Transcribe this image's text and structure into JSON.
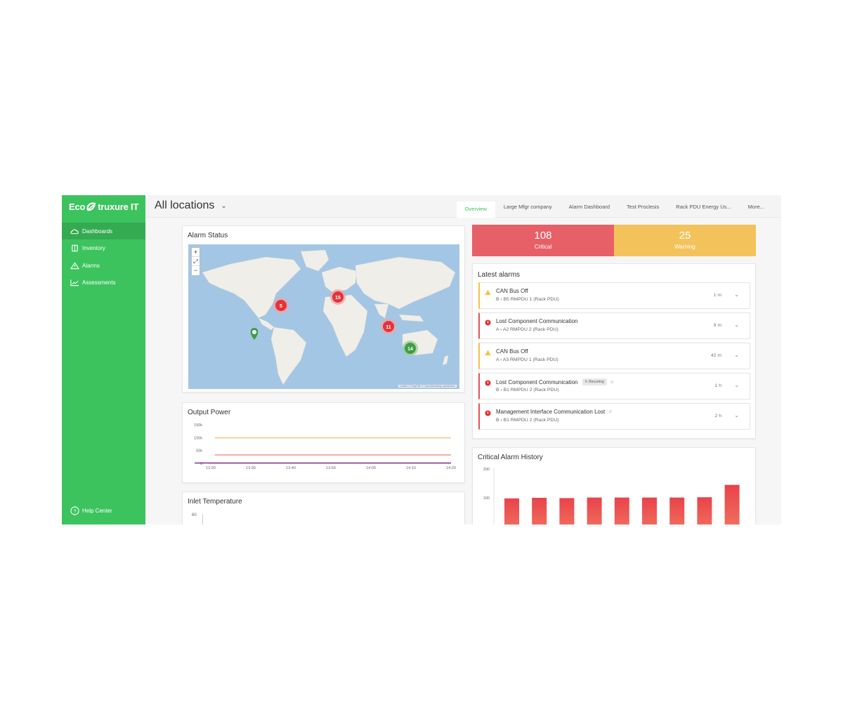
{
  "sidebar": {
    "brand_left": "Eco",
    "brand_right": "truxure IT",
    "items": [
      {
        "label": "Dashboards",
        "icon": "cloud-icon"
      },
      {
        "label": "Inventory",
        "icon": "server-icon"
      },
      {
        "label": "Alarms",
        "icon": "warning-icon"
      },
      {
        "label": "Assessments",
        "icon": "trend-icon"
      }
    ],
    "help_label": "Help Center"
  },
  "header": {
    "location": "All locations",
    "tabs": [
      "Overview",
      "Large Mfgr company",
      "Alarm Dashboard",
      "Test Proclesis",
      "Rack PDU Energy Us...",
      "More..."
    ],
    "active_tab": "Overview"
  },
  "alarm_status": {
    "title": "Alarm Status",
    "zoom_in": "+",
    "zoom_out": "−",
    "attribution": "Leaflet | © MapTiler © OpenStreetMap contributors",
    "clusters": [
      {
        "label": "5",
        "status": "critical"
      },
      {
        "label": "15",
        "status": "critical"
      },
      {
        "label": "11",
        "status": "critical"
      },
      {
        "label": "14",
        "status": "ok"
      },
      {
        "label": "",
        "status": "ok"
      }
    ]
  },
  "kpis": {
    "critical": {
      "value": "108",
      "label": "Critical"
    },
    "warning": {
      "value": "25",
      "label": "Warning"
    }
  },
  "latest_alarms": {
    "title": "Latest alarms",
    "items": [
      {
        "severity": "warning",
        "title": "CAN Bus Off",
        "path": "B  ›  B5 RMPDU 1 (Rack PDU)",
        "time": "1 m",
        "badge": "",
        "muted": false
      },
      {
        "severity": "critical",
        "title": "Lost Component Communication",
        "path": "A  ›  A2 RMPDU 2 (Rack PDU)",
        "time": "9 m",
        "badge": "",
        "muted": false
      },
      {
        "severity": "warning",
        "title": "CAN Bus Off",
        "path": "A  ›  A3 RMPDU 1 (Rack PDU)",
        "time": "42 m",
        "badge": "",
        "muted": false
      },
      {
        "severity": "critical",
        "title": "Lost Component Communication",
        "path": "B  ›  B1 RMPDU 2 (Rack PDU)",
        "time": "1 h",
        "badge": "Recurring",
        "muted": true
      },
      {
        "severity": "critical",
        "title": "Management Interface Communication Lost",
        "path": "B  ›  B1 RMPDU 2 (Rack PDU)",
        "time": "2 h",
        "badge": "",
        "muted": true
      }
    ]
  },
  "output_power": {
    "title": "Output Power"
  },
  "inlet_temperature": {
    "title": "Inlet Temperature",
    "y_tick": "60"
  },
  "critical_history": {
    "title": "Critical Alarm History"
  },
  "chart_data": [
    {
      "type": "line",
      "title": "Output Power",
      "x": [
        "13:20",
        "13:30",
        "13:40",
        "13:50",
        "14:00",
        "14:10",
        "14:20"
      ],
      "yticks": [
        "150k",
        "100k",
        "50k",
        "0"
      ],
      "ylim": [
        0,
        150000
      ],
      "x_range": [
        0,
        6
      ],
      "series": [
        {
          "color": "#f0a431",
          "x": [
            0.1,
            6
          ],
          "values": [
            99000,
            99000
          ]
        },
        {
          "color": "#e8434a",
          "x": [
            0.1,
            6
          ],
          "values": [
            33000,
            33000
          ]
        },
        {
          "color": "#8b3a8f",
          "x": [
            -0.4,
            6
          ],
          "values": [
            1500,
            1500
          ]
        }
      ],
      "grid": false
    },
    {
      "type": "bar",
      "title": "Critical Alarm History",
      "yticks": [
        "200",
        "100"
      ],
      "ylim": [
        0,
        200
      ],
      "values": [
        98,
        100,
        99,
        101,
        101,
        101,
        101,
        102,
        145
      ],
      "color": "#e8434a"
    }
  ]
}
